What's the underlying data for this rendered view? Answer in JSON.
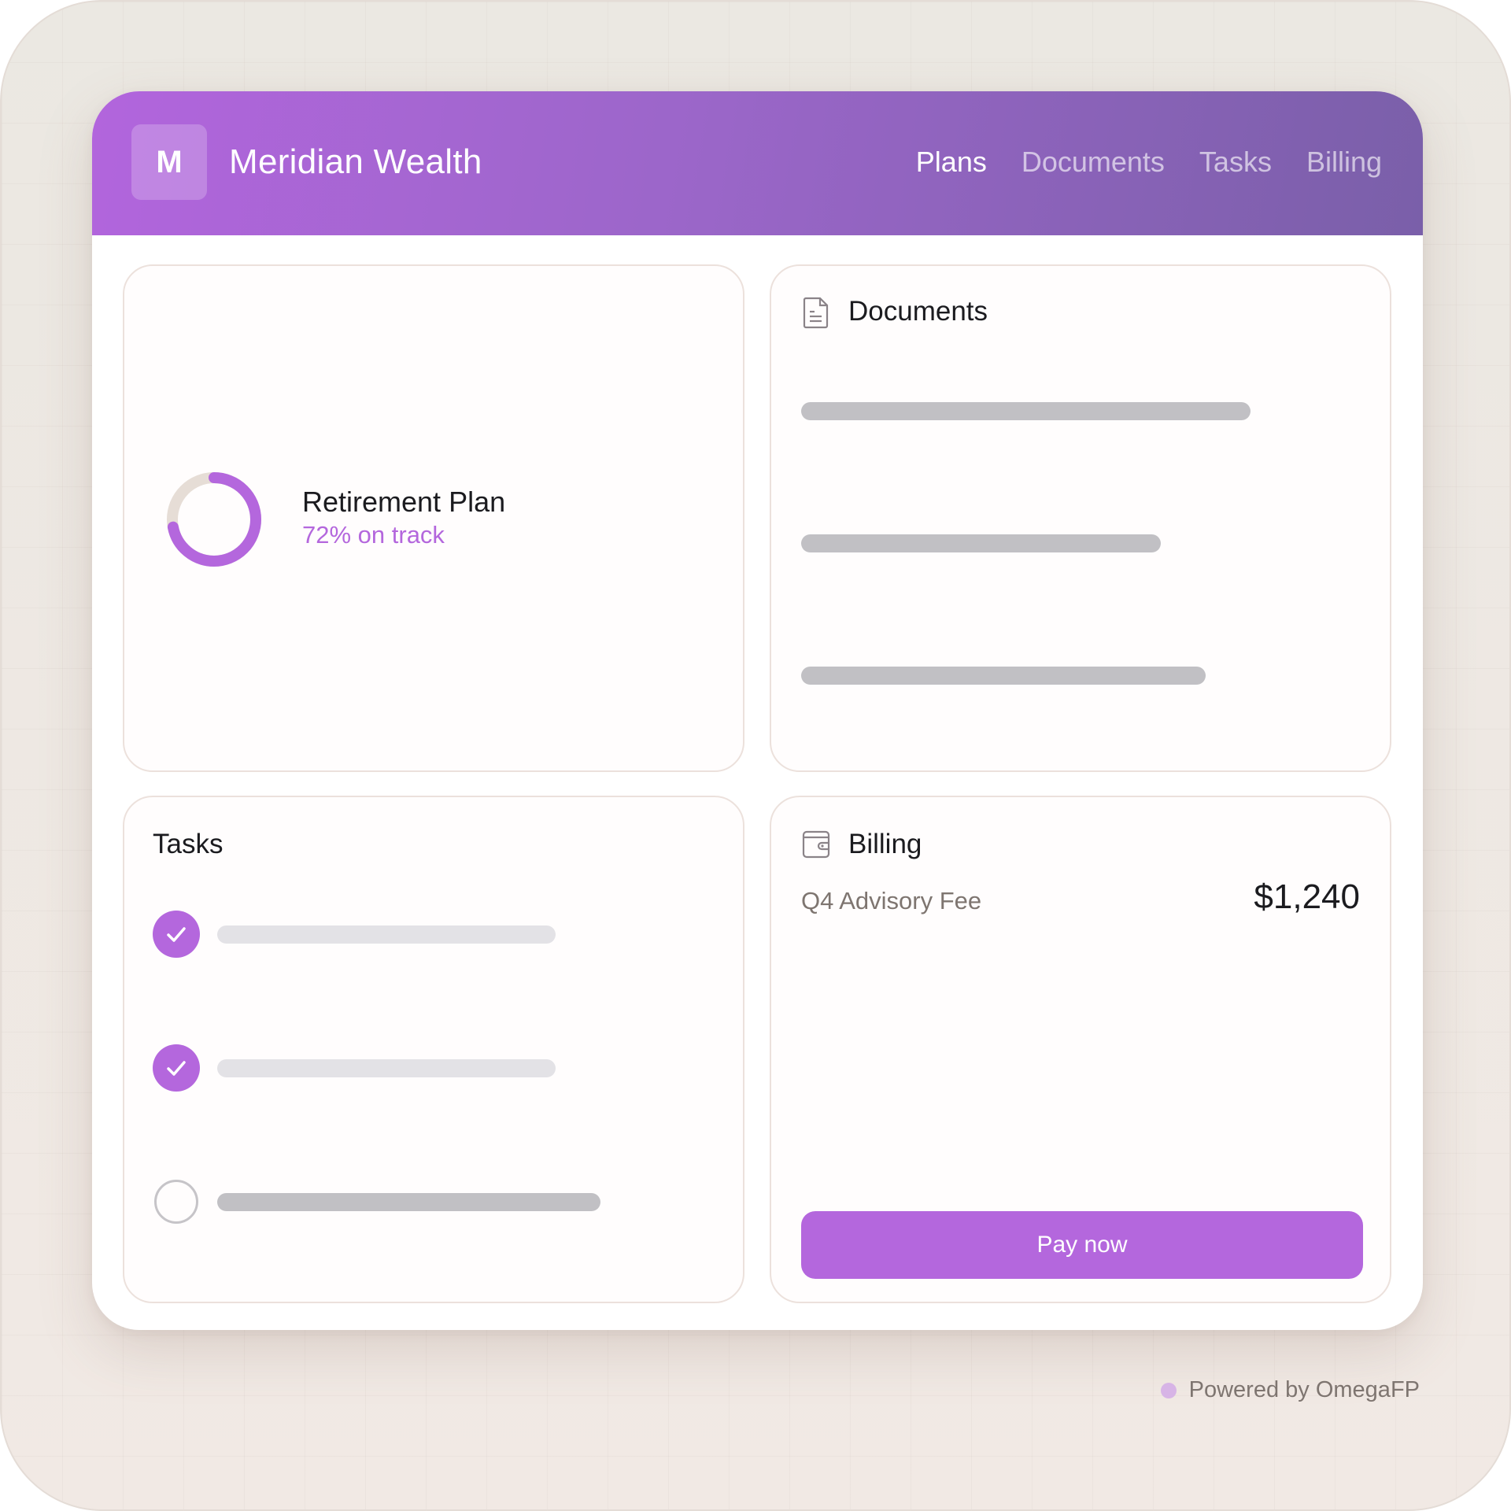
{
  "header": {
    "logo_letter": "M",
    "brand": "Meridian Wealth",
    "nav": [
      {
        "label": "Plans",
        "active": true
      },
      {
        "label": "Documents",
        "active": false
      },
      {
        "label": "Tasks",
        "active": false
      },
      {
        "label": "Billing",
        "active": false
      }
    ]
  },
  "plan_card": {
    "title": "Retirement Plan",
    "status": "72% on track",
    "progress_percent": 72,
    "ring_color": "#b467dd",
    "ring_track_color": "#e6ddd6"
  },
  "documents_card": {
    "icon": "document-icon",
    "title": "Documents",
    "placeholder_rows": 3
  },
  "tasks_card": {
    "title": "Tasks",
    "items": [
      {
        "done": true
      },
      {
        "done": true
      },
      {
        "done": false
      }
    ]
  },
  "billing_card": {
    "icon": "wallet-icon",
    "title": "Billing",
    "fee_label": "Q4 Advisory Fee",
    "amount": "$1,240",
    "pay_label": "Pay now"
  },
  "footer": {
    "powered_by": "Powered by OmegaFP"
  },
  "colors": {
    "accent": "#b467dd",
    "header_start": "#b265dd",
    "header_end": "#7a5fa9"
  }
}
